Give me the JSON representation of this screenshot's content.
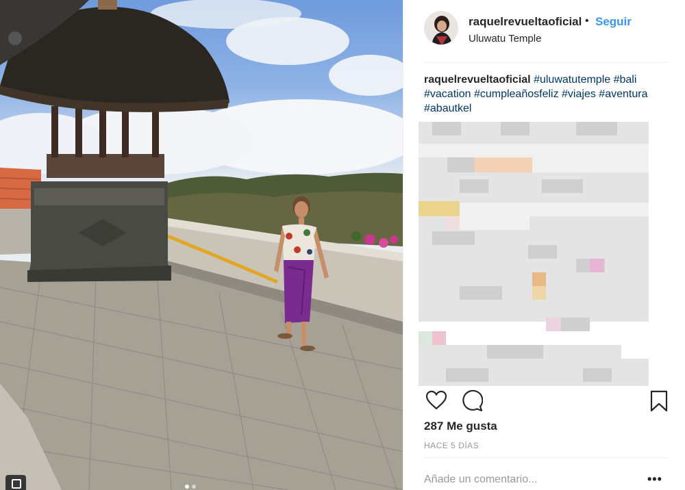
{
  "post": {
    "username": "raquelrevueltaoficial",
    "separator": "•",
    "follow_label": "Seguir",
    "location": "Uluwatu Temple",
    "caption": {
      "user": "raquelrevueltaoficial",
      "hashtags": [
        "#uluwatutemple",
        "#bali",
        "#vacation",
        "#cumpleañosfeliz",
        "#viajes",
        "#aventura",
        "#abautkel"
      ]
    },
    "likes": "287 Me gusta",
    "time": "HACE 5 DÍAS",
    "comment_placeholder": "Añade un comentario...",
    "more_label": "•••"
  },
  "icons": {
    "like": "heart-icon",
    "comment": "comment-bubble-icon",
    "save": "bookmark-icon",
    "multi": "multiple-photos-icon"
  },
  "colors": {
    "follow": "#3897f0",
    "hashtag": "#003569",
    "muted": "#999999",
    "text": "#262626"
  },
  "carousel": {
    "count": 2,
    "active": 1
  }
}
